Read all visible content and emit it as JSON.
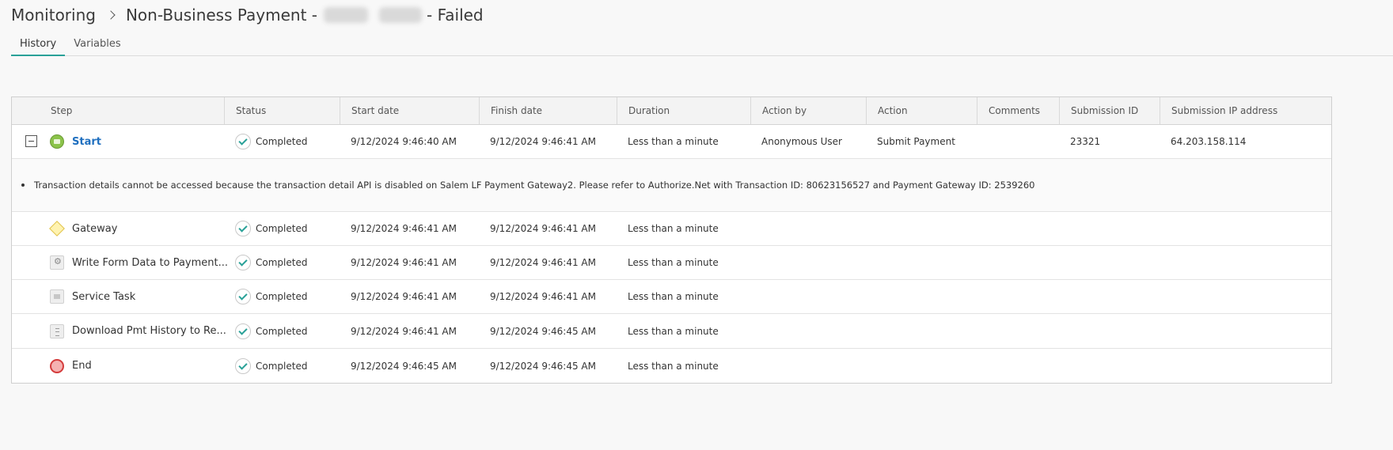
{
  "breadcrumb": {
    "root": "Monitoring",
    "page_prefix": "Non-Business Payment -",
    "page_suffix": "- Failed"
  },
  "tabs": [
    {
      "label": "History",
      "active": true
    },
    {
      "label": "Variables",
      "active": false
    }
  ],
  "colors": {
    "accent": "#2aa198",
    "link": "#1f6fbf",
    "end_red": "#d43c3c",
    "start_green": "#8bc34a"
  },
  "table": {
    "columns": [
      "Step",
      "Status",
      "Start date",
      "Finish date",
      "Duration",
      "Action by",
      "Action",
      "Comments",
      "Submission ID",
      "Submission IP address"
    ],
    "message": "Transaction details cannot be accessed because the transaction detail API is disabled on Salem LF Payment Gateway2. Please refer to Authorize.Net with Transaction ID: 80623156527 and Payment Gateway ID: 2539260",
    "rows": [
      {
        "step": "Start",
        "icon": "start-event-icon",
        "status": "Completed",
        "start": "9/12/2024 9:46:40 AM",
        "finish": "9/12/2024 9:46:41 AM",
        "duration": "Less than a minute",
        "action_by": "Anonymous User",
        "action": "Submit Payment",
        "comments": "",
        "submission_id": "23321",
        "ip": "64.203.158.114"
      },
      {
        "step": "Gateway",
        "icon": "gateway-icon",
        "status": "Completed",
        "start": "9/12/2024 9:46:41 AM",
        "finish": "9/12/2024 9:46:41 AM",
        "duration": "Less than a minute",
        "action_by": "",
        "action": "",
        "comments": "",
        "submission_id": "",
        "ip": ""
      },
      {
        "step": "Write Form Data to Payment...",
        "icon": "gear-icon",
        "status": "Completed",
        "start": "9/12/2024 9:46:41 AM",
        "finish": "9/12/2024 9:46:41 AM",
        "duration": "Less than a minute",
        "action_by": "",
        "action": "",
        "comments": "",
        "submission_id": "",
        "ip": ""
      },
      {
        "step": "Service Task",
        "icon": "mail-icon",
        "status": "Completed",
        "start": "9/12/2024 9:46:41 AM",
        "finish": "9/12/2024 9:46:41 AM",
        "duration": "Less than a minute",
        "action_by": "",
        "action": "",
        "comments": "",
        "submission_id": "",
        "ip": ""
      },
      {
        "step": "Download Pmt History to Re...",
        "icon": "document-icon",
        "status": "Completed",
        "start": "9/12/2024 9:46:41 AM",
        "finish": "9/12/2024 9:46:45 AM",
        "duration": "Less than a minute",
        "action_by": "",
        "action": "",
        "comments": "",
        "submission_id": "",
        "ip": ""
      },
      {
        "step": "End",
        "icon": "end-event-icon",
        "status": "Completed",
        "start": "9/12/2024 9:46:45 AM",
        "finish": "9/12/2024 9:46:45 AM",
        "duration": "Less than a minute",
        "action_by": "",
        "action": "",
        "comments": "",
        "submission_id": "",
        "ip": ""
      }
    ]
  }
}
